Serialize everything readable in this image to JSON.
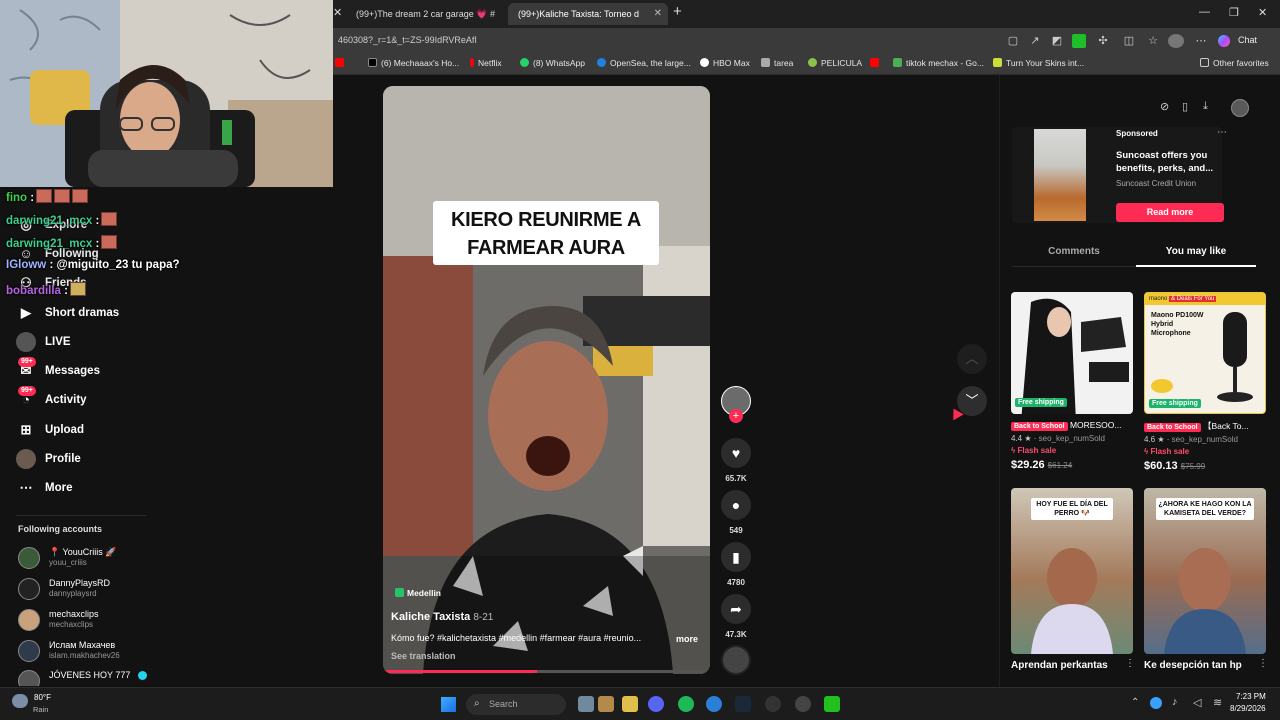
{
  "browser": {
    "tabs": [
      {
        "label": "(99+)The dream 2 car garage 💗 #",
        "active": false
      },
      {
        "label": "(99+)Kaliche Taxista: Torneo d",
        "active": true
      }
    ],
    "url": "460308?_r=1&_t=ZS-99IdRVReAfI",
    "chat_label": "Chat",
    "bookmarks": [
      "(6) Mechaaax's Ho...",
      "Netflix",
      "(8) WhatsApp",
      "OpenSea, the large...",
      "HBO Max",
      "tarea",
      "PELICULA",
      "tiktok mechax - Go...",
      "Turn Your Skins int...",
      "Other favorites"
    ]
  },
  "chat": [
    {
      "user": "fino",
      "text": ":",
      "user_color": "#3ecf4c"
    },
    {
      "user": "darwing21_mcx",
      "text": ":",
      "user_color": "#3ecf8e"
    },
    {
      "user": "darwing21_mcx",
      "text": ":",
      "user_color": "#3ecf8e"
    },
    {
      "user": "IGloww",
      "text": ": @miguito_23 tu papa?",
      "user_color": "#b9c7ff"
    },
    {
      "user": "bobardilla",
      "text": ":",
      "user_color": "#b565e0"
    }
  ],
  "sidebar": {
    "hidden_items": [
      "Explore",
      "Following",
      "Friends"
    ],
    "items": [
      {
        "label": "Short dramas",
        "icon": "film-icon"
      },
      {
        "label": "LIVE",
        "icon": "live-icon"
      },
      {
        "label": "Messages",
        "icon": "messages-icon",
        "badge": "99+"
      },
      {
        "label": "Activity",
        "icon": "activity-icon",
        "badge": "99+"
      },
      {
        "label": "Upload",
        "icon": "upload-icon"
      },
      {
        "label": "Profile",
        "icon": "profile-icon"
      },
      {
        "label": "More",
        "icon": "more-icon"
      }
    ],
    "following_title": "Following accounts",
    "accounts": [
      {
        "name": "📍 YouuCriiis 🚀",
        "user": "youu_criiis"
      },
      {
        "name": "DannyPlaysRD",
        "user": "dannyplaysrd"
      },
      {
        "name": "mechaxclips",
        "user": "mechaxclips"
      },
      {
        "name": "Ислам Махачев",
        "user": "islam.makhachev26"
      },
      {
        "name": "JÓVENES HOY 777",
        "user": ""
      }
    ]
  },
  "video": {
    "caption": "KIERO REUNIRME A FARMEAR AURA",
    "location": "Medellin",
    "author": "Kaliche Taxista",
    "date": "8-21",
    "description": "Kómo fue? #kalichetaxista #medellin #farmear #aura #reunio...",
    "more": "more",
    "translate": "See translation",
    "progress": 0.47
  },
  "actions": {
    "likes": "65.7K",
    "comments": "549",
    "saves": "4780",
    "shares": "47.3K"
  },
  "right": {
    "ad": {
      "sponsored": "Sponsored",
      "title": "Suncoast offers you benefits, perks, and...",
      "brand": "Suncoast Credit Union",
      "cta": "Read more"
    },
    "tabs": [
      "Comments",
      "You may like"
    ],
    "products": [
      {
        "badge": "Back to School",
        "title": "MORESOO...",
        "rating": "4.4",
        "sold": "seo_kep_numSold",
        "flash": "Flash sale",
        "price": "$29.26",
        "old_price": "$61.24",
        "shipping": "Free shipping"
      },
      {
        "badge": "Back to School",
        "title": "【Back To...",
        "rating": "4.6",
        "sold": "seo_kep_numSold",
        "flash": "Flash sale",
        "price": "$60.13",
        "old_price": "$75.99",
        "shipping": "Free shipping",
        "thumb_brand": "maono",
        "thumb_tag": "& Deals For You",
        "thumb_text": "Maono PD100W Hybrid Microphone"
      }
    ],
    "videos": [
      {
        "overlay": "HOY FUE EL DÍA DEL PERRO 🐶",
        "title": "Aprendan perkantas"
      },
      {
        "overlay": "¿AHORA KE HAGO KON LA KAMISETA DEL VERDE?",
        "title": "Ke desepción tan hp"
      }
    ]
  },
  "taskbar": {
    "weather_temp": "80°F",
    "weather_desc": "Rain",
    "search": "Search",
    "time": "7:23 PM",
    "date": "8/29/2026"
  }
}
